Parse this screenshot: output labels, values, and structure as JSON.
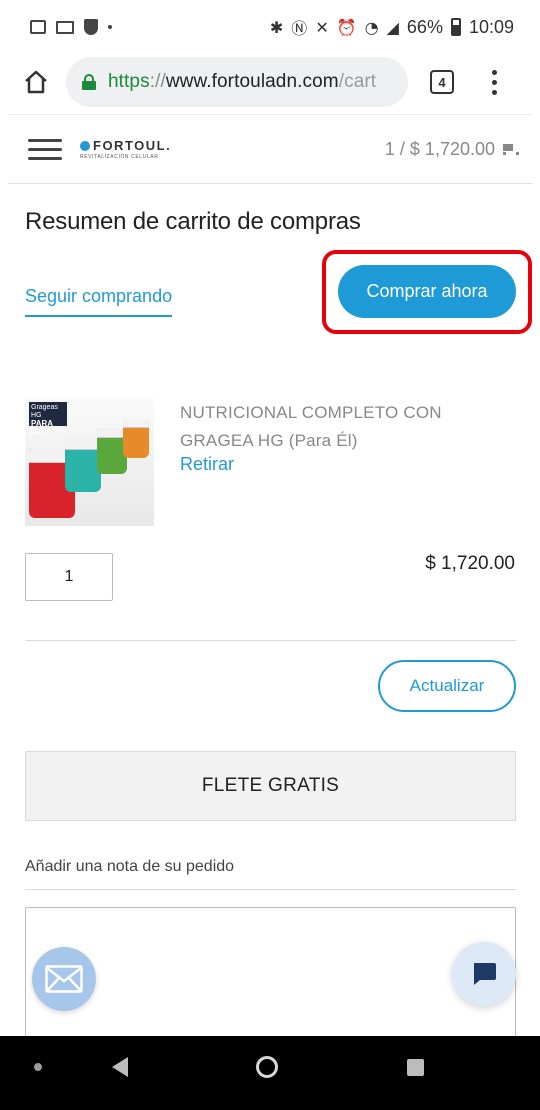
{
  "status_bar": {
    "battery": "66%",
    "time": "10:09"
  },
  "browser": {
    "url_scheme": "https",
    "url_sep": "://",
    "url_host": "www.fortouladn.com",
    "url_path": "/cart",
    "tab_count": "4"
  },
  "header": {
    "logo_name": "FORTOUL.",
    "logo_tagline": "REVITALIZACIÓN CELULAR",
    "cart_summary": "1 / $ 1,720.00"
  },
  "cart": {
    "title": "Resumen de carrito de compras",
    "continue_label": "Seguir comprando",
    "buy_now_label": "Comprar ahora",
    "item": {
      "image_badge_top": "Grageas HG",
      "image_badge_bottom": "PARA ÉL",
      "name": "NUTRICIONAL COMPLETO CON GRAGEA HG (Para Él)",
      "remove_label": "Retirar",
      "quantity": "1",
      "price": "$ 1,720.00"
    },
    "update_label": "Actualizar",
    "shipping_label": "FLETE GRATIS",
    "note_label": "Añadir una nota de su pedido"
  },
  "colors": {
    "accent": "#1e9ad6",
    "highlight": "#e8000b",
    "secure": "#1a8a3b"
  }
}
